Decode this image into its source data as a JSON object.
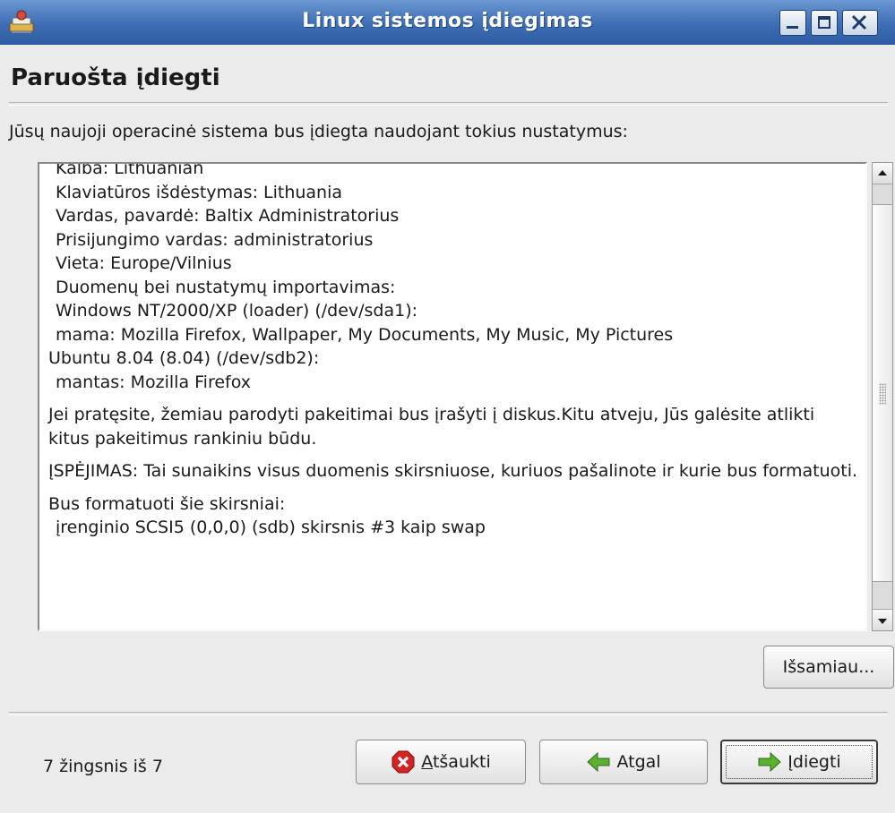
{
  "window": {
    "title": "Linux sistemos įdiegimas"
  },
  "page": {
    "heading": "Paruošta įdiegti",
    "intro": "Jūsų naujoji operacinė sistema bus įdiegta naudojant tokius nustatymus:"
  },
  "summary": {
    "lines": [
      "Kalba: Lithuanian",
      "Klaviatūros išdėstymas: Lithuania",
      "Vardas, pavardė: Baltix Administratorius",
      "Prisijungimo vardas: administratorius",
      "Vieta: Europe/Vilnius",
      "Duomenų bei nustatymų importavimas:",
      "Windows NT/2000/XP (loader) (/dev/sda1):",
      "mama: Mozilla Firefox, Wallpaper, My Documents, My Music, My Pictures",
      "Ubuntu 8.04 (8.04) (/dev/sdb2):",
      "mantas: Mozilla Firefox"
    ],
    "paragraph1": "Jei pratęsite, žemiau parodyti pakeitimai bus įrašyti į diskus.Kitu atveju, Jūs galėsite atlikti kitus pakeitimus rankiniu būdu.",
    "warning": "ĮSPĖJIMAS: Tai sunaikins visus duomenis skirsniuose, kuriuos pašalinote ir kurie bus formatuoti.",
    "format_heading": "Bus formatuoti šie skirsniai:",
    "format_item": "įrenginio SCSI5 (0,0,0) (sdb) skirsnis #3 kaip swap"
  },
  "buttons": {
    "details": "Išsamiau...",
    "cancel_mnemonic": "A",
    "cancel_rest": "tšaukti",
    "back_pre": "At",
    "back_mnemonic": "g",
    "back_post": "al",
    "install_mnemonic": "Į",
    "install_rest": "diegti"
  },
  "footer": {
    "step": "7 žingsnis iš 7"
  },
  "icons": {
    "app": "installer-icon",
    "cancel": "stop-x-icon",
    "back": "arrow-left-icon",
    "install": "arrow-right-icon"
  },
  "colors": {
    "titlebar": "#3d6db3",
    "cancel_icon": "#d42323",
    "arrow_icon": "#5cb030"
  }
}
